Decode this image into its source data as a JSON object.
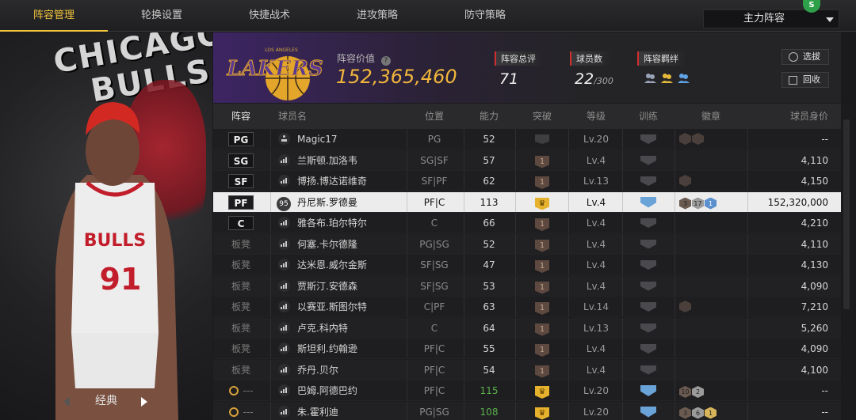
{
  "tabs": [
    "阵容管理",
    "轮换设置",
    "快捷战术",
    "进攻策略",
    "防守策略"
  ],
  "lineup_select": {
    "value": "主力阵容"
  },
  "corner_badge": "S",
  "left_panel": {
    "team_text_1": "CHICAGO",
    "team_text_2": "BULLS",
    "jersey_text": "BULLS",
    "jersey_number": "91",
    "card_style": "经典"
  },
  "team": {
    "logo_text": "LAKERS",
    "logo_sub": "LOS ANGELES"
  },
  "lineup_value": {
    "label": "阵容价值",
    "value": "152,365,460"
  },
  "stats": {
    "rating": {
      "label": "阵容总评",
      "value": "71"
    },
    "players": {
      "label": "球员数",
      "value": "22",
      "max": "/300"
    },
    "synergy": {
      "label": "阵容羁绊"
    }
  },
  "buttons": {
    "select": "选拔",
    "recycle": "回收"
  },
  "columns": {
    "pos": "阵容",
    "name": "球员名",
    "position": "位置",
    "ovr": "能力",
    "breakthrough": "突破",
    "level": "等级",
    "training": "训练",
    "badges": "徽章",
    "price": "球员身价"
  },
  "rows": [
    {
      "slot": "PG",
      "name": "Magic17",
      "position": "PG",
      "ovr": "52",
      "level": "Lv.20",
      "price": "--"
    },
    {
      "slot": "SG",
      "name": "兰斯顿.加洛韦",
      "position": "SG|SF",
      "ovr": "57",
      "brk": "1",
      "level": "Lv.4",
      "price": "4,110"
    },
    {
      "slot": "SF",
      "name": "博扬.博达诺维奇",
      "position": "SF|PF",
      "ovr": "62",
      "brk": "1",
      "level": "Lv.13",
      "price": "4,150"
    },
    {
      "slot": "PF",
      "name": "丹尼斯.罗德曼",
      "ovr_badge": "95",
      "position": "PF|C",
      "ovr": "113",
      "level": "Lv.4",
      "badge_a": "3",
      "badge_b": "17",
      "badge_c": "1",
      "price": "152,320,000"
    },
    {
      "slot": "C",
      "name": "雅各布.珀尔特尔",
      "position": "C",
      "ovr": "66",
      "brk": "1",
      "level": "Lv.4",
      "price": "4,210"
    },
    {
      "slot": "板凳",
      "name": "何塞.卡尔德隆",
      "position": "PG|SG",
      "ovr": "52",
      "brk": "1",
      "level": "Lv.4",
      "price": "4,110"
    },
    {
      "slot": "板凳",
      "name": "达米恩.威尔金斯",
      "position": "SF|SG",
      "ovr": "47",
      "brk": "1",
      "level": "Lv.4",
      "price": "4,130"
    },
    {
      "slot": "板凳",
      "name": "贾斯汀.安德森",
      "position": "SF|SG",
      "ovr": "53",
      "brk": "1",
      "level": "Lv.4",
      "price": "4,090"
    },
    {
      "slot": "板凳",
      "name": "以赛亚.斯图尔特",
      "position": "C|PF",
      "ovr": "63",
      "brk": "1",
      "level": "Lv.14",
      "price": "7,210"
    },
    {
      "slot": "板凳",
      "name": "卢克.科内特",
      "position": "C",
      "ovr": "64",
      "brk": "1",
      "level": "Lv.13",
      "price": "5,260"
    },
    {
      "slot": "板凳",
      "name": "斯坦利.约翰逊",
      "position": "PF|C",
      "ovr": "55",
      "brk": "1",
      "level": "Lv.4",
      "price": "4,090"
    },
    {
      "slot": "板凳",
      "name": "乔丹.贝尔",
      "position": "PF|C",
      "ovr": "54",
      "brk": "1",
      "level": "Lv.4",
      "price": "4,100"
    },
    {
      "slot": "---",
      "name": "巴姆.阿德巴约",
      "position": "PF|C",
      "ovr": "115",
      "level": "Lv.20",
      "badge_a": "10",
      "badge_b": "2",
      "price": "--"
    },
    {
      "slot": "---",
      "name": "朱.霍利迪",
      "position": "PG|SG",
      "ovr": "108",
      "level": "Lv.20",
      "badge_a": "3",
      "badge_b": "6",
      "badge_c": "1",
      "price": "--"
    }
  ]
}
